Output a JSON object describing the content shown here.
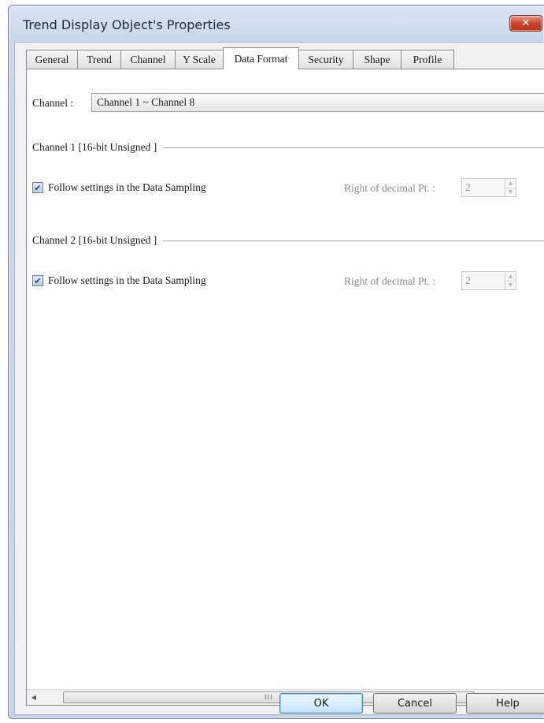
{
  "window": {
    "title": "Trend Display Object's Properties",
    "close_glyph": "✕",
    "close_icon": "close-icon"
  },
  "tabs": [
    {
      "label": "General"
    },
    {
      "label": "Trend"
    },
    {
      "label": "Channel"
    },
    {
      "label": "Y Scale"
    },
    {
      "label": "Data Format",
      "active": true
    },
    {
      "label": "Security"
    },
    {
      "label": "Shape"
    },
    {
      "label": "Profile"
    }
  ],
  "channel_select": {
    "label": "Channel :",
    "value": "Channel 1 ~ Channel 8"
  },
  "groups": [
    {
      "title": "Channel 1 [16-bit Unsigned ]",
      "follow_label": "Follow settings in the Data Sampling",
      "follow_checked": true,
      "decimal_label": "Right of decimal Pt. :",
      "decimal_value": "2"
    },
    {
      "title": "Channel 2 [16-bit Unsigned ]",
      "follow_label": "Follow settings in the Data Sampling",
      "follow_checked": true,
      "decimal_label": "Right of decimal Pt. :",
      "decimal_value": "2"
    }
  ],
  "scrollbar": {
    "left_glyph": "◀",
    "right_glyph": "▶",
    "thumb_grip": "III"
  },
  "buttons": {
    "ok": "OK",
    "cancel": "Cancel",
    "help": "Help"
  },
  "check_glyph": "✔",
  "spin_up_glyph": "▲",
  "spin_down_glyph": "▼",
  "colors": {
    "titlebar": "#c9d8ea",
    "close_button": "#c7452c",
    "default_button_border": "#3c7fb1"
  }
}
